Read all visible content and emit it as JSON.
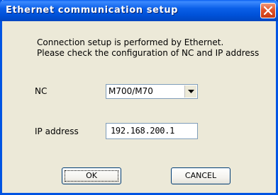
{
  "window": {
    "title": "Ethernet communication setup"
  },
  "message": {
    "line1": "Connection setup is performed by Ethernet.",
    "line2": "Please check the configuration of NC and IP address"
  },
  "nc": {
    "label": "NC",
    "selected": "M700/M70"
  },
  "ip": {
    "label": "IP address",
    "value": "192.168.200.1"
  },
  "buttons": {
    "ok": "OK",
    "cancel": "CANCEL"
  },
  "icons": {
    "close": "close-icon",
    "dropdown": "chevron-down-icon"
  },
  "colors": {
    "titlebar": "#0054e3",
    "close": "#e2542a",
    "face": "#ece9d8"
  }
}
